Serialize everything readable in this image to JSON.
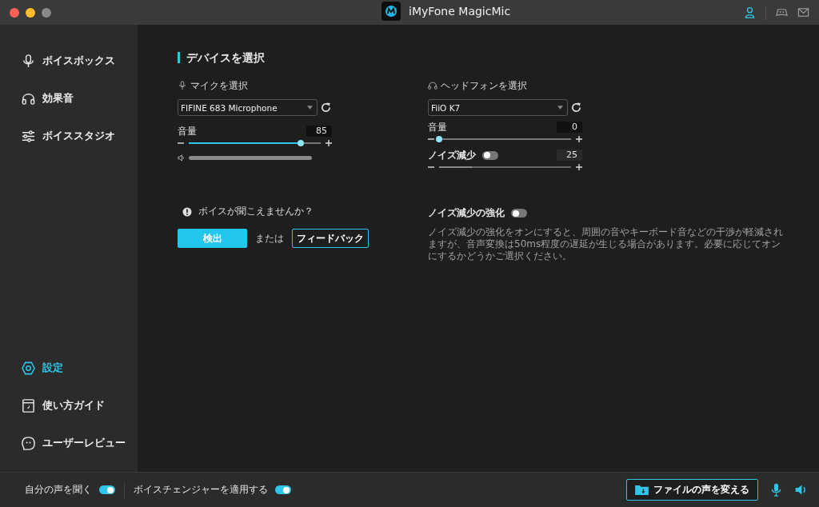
{
  "window": {
    "title": "iMyFone MagicMic"
  },
  "sidebar": {
    "top_items": [
      {
        "label": "ボイスボックス",
        "selected": false
      },
      {
        "label": "効果音",
        "selected": false
      },
      {
        "label": "ボイススタジオ",
        "selected": false
      }
    ],
    "bottom_items": [
      {
        "label": "設定",
        "selected": true
      },
      {
        "label": "使い方ガイド",
        "selected": false
      },
      {
        "label": "ユーザーレビュー",
        "selected": false
      }
    ]
  },
  "section_title": "デバイスを選択",
  "microphone": {
    "label": "マイクを選択",
    "device": "FIFINE 683 Microphone",
    "volume": {
      "label": "音量",
      "value": "85",
      "level": 0.85
    }
  },
  "headphone": {
    "label": "ヘッドフォンを選択",
    "device": "FiiO K7",
    "volume": {
      "label": "音量",
      "value": "0",
      "level": 0
    },
    "noise_reduction": {
      "label": "ノイズ減少",
      "on": false,
      "value": "25",
      "level": 0.25
    }
  },
  "help": {
    "prompt": "ボイスが聞こえませんか？",
    "detect_button": "検出",
    "or_text": "または",
    "feedback_button": "フィードバック"
  },
  "enhance": {
    "label": "ノイズ減少の強化",
    "on": false,
    "description": "ノイズ減少の強化をオンにすると、周囲の音やキーボード音などの干渉が軽減されますが、音声変換は50ms程度の遅延が生じる場合があります。必要に応じてオンにするかどうかご選択ください。"
  },
  "bottom_bar": {
    "monitor": {
      "label": "自分の声を聞く",
      "on": true
    },
    "apply": {
      "label": "ボイスチェンジャーを適用する",
      "on": true
    },
    "file_button": "ファイルの声を変える"
  }
}
